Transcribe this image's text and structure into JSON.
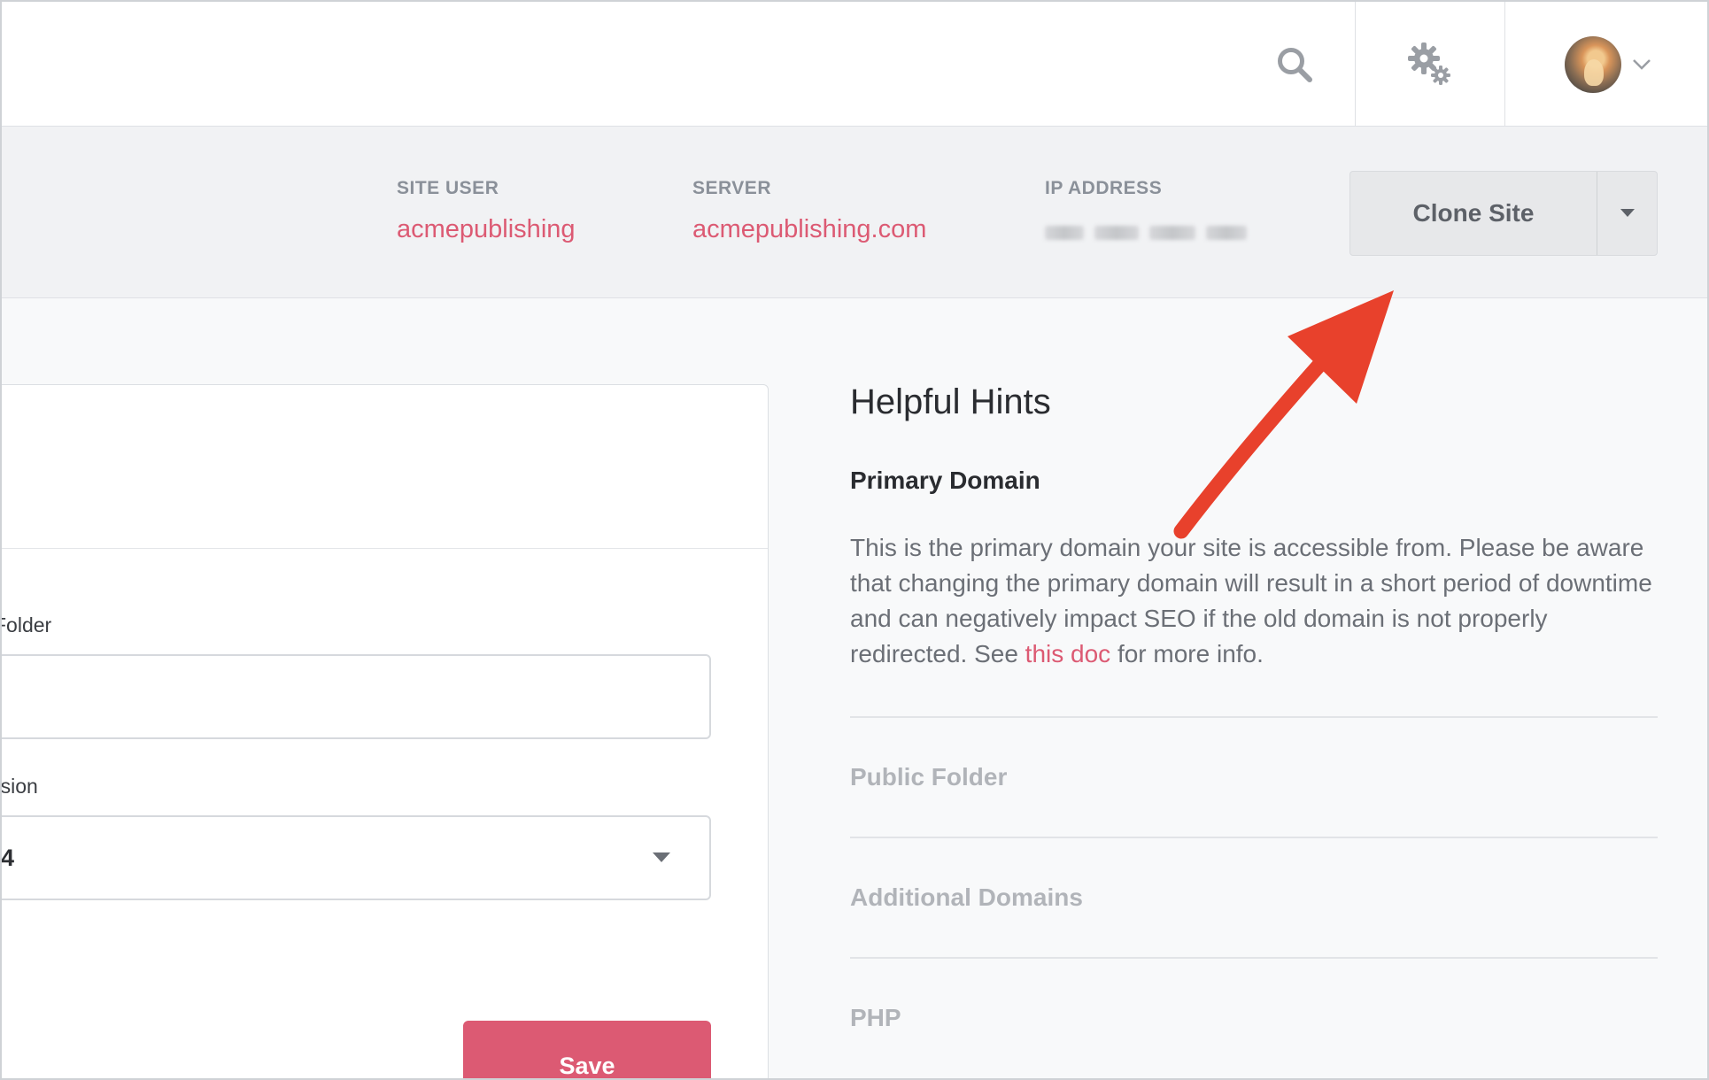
{
  "topbar": {
    "search_icon": "search-icon",
    "settings_icon": "gears-icon",
    "user_icon": "avatar",
    "user_menu_icon": "chevron-down-icon"
  },
  "site_info": {
    "site_user": {
      "label": "SITE USER",
      "value": "acmepublishing"
    },
    "server": {
      "label": "SERVER",
      "value": "acmepublishing.com"
    },
    "ip_address": {
      "label": "IP ADDRESS"
    },
    "clone_button": "Clone Site"
  },
  "form": {
    "public_folder_label": "Folder",
    "public_folder_value": "",
    "php_version_label": "rsion",
    "php_version_value": "4",
    "save_label": "Save"
  },
  "hints": {
    "title": "Helpful Hints",
    "active_title": "Primary Domain",
    "body_before_link": "This is the primary domain your site is accessible from. Please be aware that changing the primary domain will result in a short period of downtime and can negatively impact SEO if the old domain is not properly redirected. See ",
    "link_text": "this doc",
    "body_after_link": " for more info.",
    "items": [
      {
        "label": "Public Folder"
      },
      {
        "label": "Additional Domains"
      },
      {
        "label": "PHP"
      }
    ]
  },
  "colors": {
    "accent": "#dc5a73",
    "annotation_arrow": "#e8412c"
  }
}
